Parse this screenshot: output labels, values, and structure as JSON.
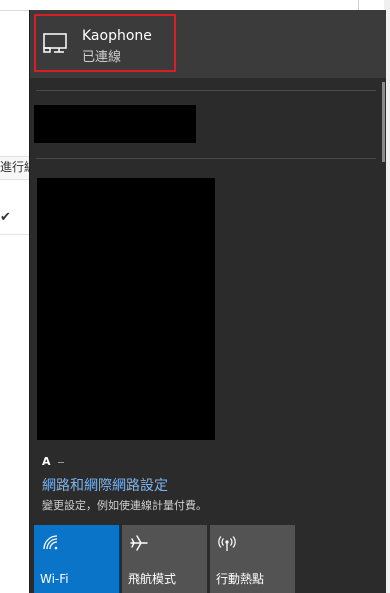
{
  "background": {
    "tab_fragment": "進行編",
    "check_glyph": "✔"
  },
  "network": {
    "name": "Kaophone",
    "status": "已連線",
    "icon": "monitor-icon"
  },
  "settings": {
    "small_label": "A",
    "link": "網路和網際網路設定",
    "description": "變更設定，例如使連線計量付費。"
  },
  "quick_actions": [
    {
      "label": "Wi-Fi",
      "icon": "wifi-icon",
      "active": true
    },
    {
      "label": "飛航模式",
      "icon": "airplane-icon",
      "active": false
    },
    {
      "label": "行動熱點",
      "icon": "hotspot-icon",
      "active": false
    }
  ],
  "colors": {
    "panel": "#2b2b2b",
    "selected_item": "#3b3b3b",
    "highlight": "#d81e26",
    "link": "#7cb3f0",
    "tile_active": "#0a74c9",
    "tile_inactive": "#535353"
  }
}
